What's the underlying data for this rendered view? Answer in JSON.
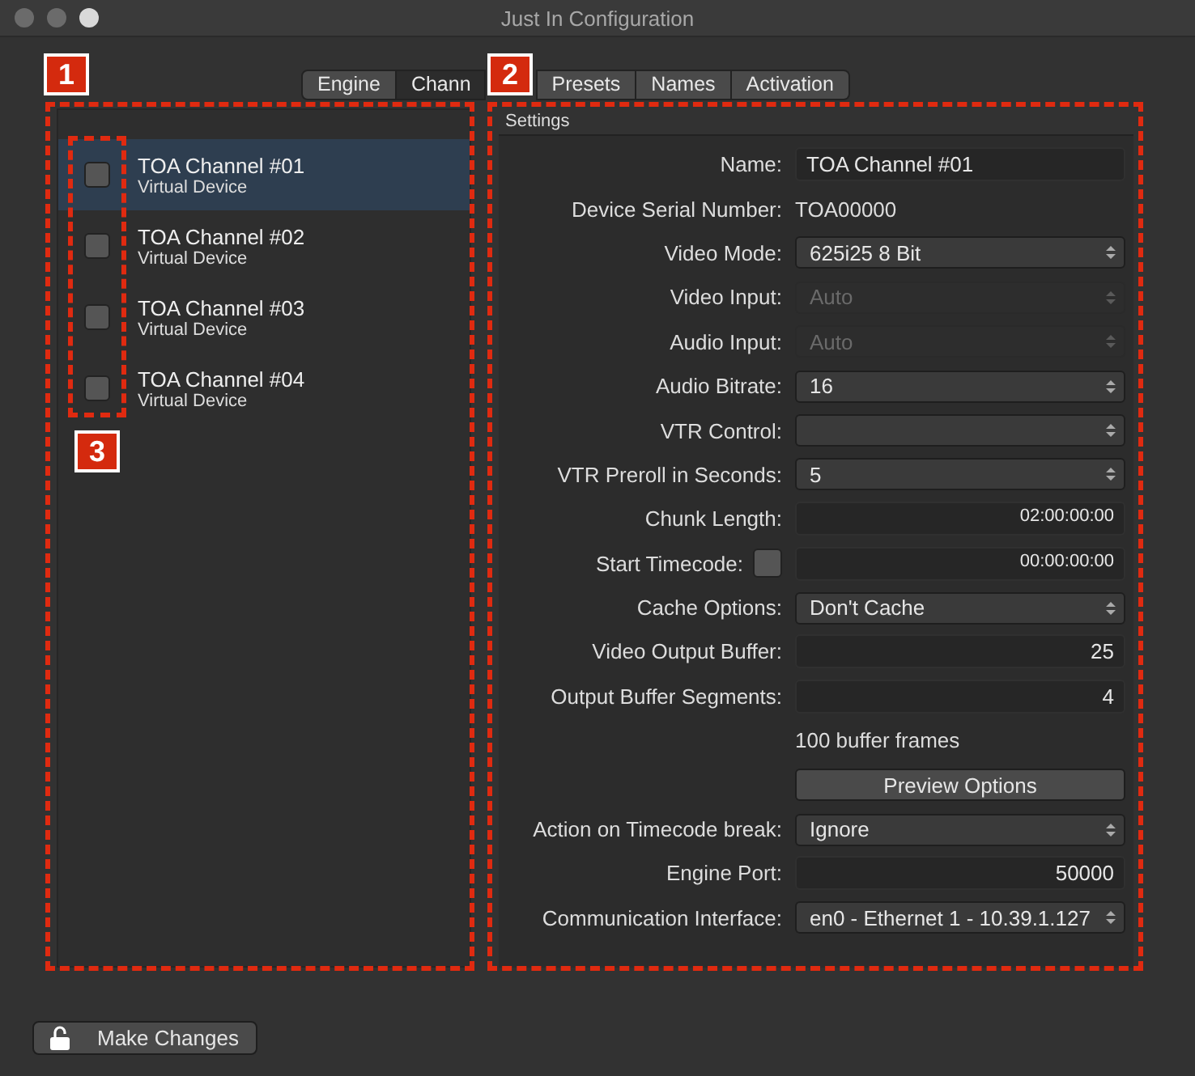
{
  "window": {
    "title": "Just In Configuration"
  },
  "tabs": [
    {
      "label": "Engine",
      "selected": false
    },
    {
      "label": "Chann",
      "selected": true
    },
    {
      "label": "Presets",
      "selected": false
    },
    {
      "label": "Names",
      "selected": false
    },
    {
      "label": "Activation",
      "selected": false
    }
  ],
  "channels": [
    {
      "name": "TOA Channel #01",
      "subtitle": "Virtual Device",
      "checked": false,
      "selected": true
    },
    {
      "name": "TOA Channel #02",
      "subtitle": "Virtual Device",
      "checked": false,
      "selected": false
    },
    {
      "name": "TOA Channel #03",
      "subtitle": "Virtual Device",
      "checked": false,
      "selected": false
    },
    {
      "name": "TOA Channel #04",
      "subtitle": "Virtual Device",
      "checked": false,
      "selected": false
    }
  ],
  "settings": {
    "title": "Settings",
    "rows": [
      {
        "kind": "text",
        "label": "Name:",
        "value": "TOA Channel #01"
      },
      {
        "kind": "static",
        "label": "Device Serial Number:",
        "value": "TOA00000"
      },
      {
        "kind": "select",
        "label": "Video Mode:",
        "value": "625i25 8 Bit",
        "disabled": false
      },
      {
        "kind": "select",
        "label": "Video Input:",
        "value": "Auto",
        "disabled": true
      },
      {
        "kind": "select",
        "label": "Audio Input:",
        "value": "Auto",
        "disabled": true
      },
      {
        "kind": "select",
        "label": "Audio Bitrate:",
        "value": "16",
        "disabled": false
      },
      {
        "kind": "select",
        "label": "VTR Control:",
        "disabled": false
      },
      {
        "kind": "select",
        "label": "VTR Preroll in Seconds:",
        "value": "5",
        "disabled": false
      },
      {
        "kind": "number",
        "label": "Chunk Length:",
        "value": "02:00:00:00"
      },
      {
        "kind": "checknumber",
        "label": "Start Timecode:",
        "value": "00:00:00:00",
        "checked": false
      },
      {
        "kind": "select",
        "label": "Cache Options:",
        "value": "Don't Cache",
        "disabled": false
      },
      {
        "kind": "number",
        "label": "Video Output Buffer:",
        "value": "25"
      },
      {
        "kind": "number",
        "label": "Output Buffer Segments:",
        "value": "4"
      },
      {
        "kind": "note",
        "value": "100 buffer frames"
      },
      {
        "kind": "button",
        "value": "Preview Options"
      },
      {
        "kind": "select",
        "label": "Action on Timecode break:",
        "value": "Ignore",
        "disabled": false
      },
      {
        "kind": "number",
        "label": "Engine Port:",
        "value": "50000"
      },
      {
        "kind": "select",
        "label": "Communication Interface:",
        "value": "en0 - Ethernet 1 - 10.39.1.127",
        "disabled": false
      }
    ]
  },
  "lock_button": {
    "label": "Make Changes"
  },
  "callouts": [
    "1",
    "2",
    "3"
  ]
}
